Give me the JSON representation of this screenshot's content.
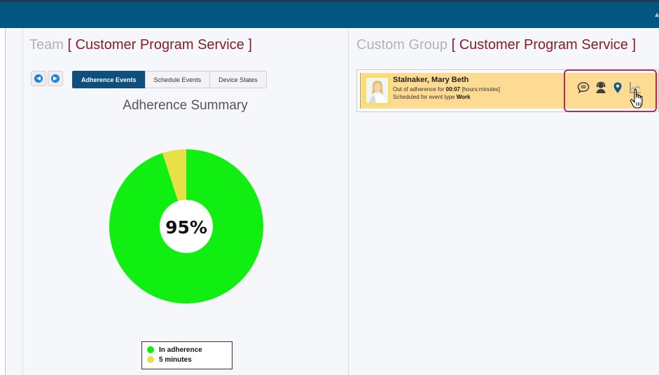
{
  "team_panel": {
    "title_prefix": "Team",
    "title_name": "[ Customer Program Service ]",
    "tabs": [
      "Adherence Events",
      "Schedule Events",
      "Device States"
    ],
    "active_tab": "Adherence Events",
    "chart_heading": "Adherence Summary"
  },
  "chart_data": {
    "type": "pie",
    "style": "donut",
    "center_label": "95%",
    "slices": [
      {
        "label": "In adherence",
        "value": 95,
        "color": "#11ee11"
      },
      {
        "label": "5 minutes",
        "value": 5,
        "color": "#e5e146"
      }
    ],
    "legend_placement": "bottom"
  },
  "group_panel": {
    "title_prefix": "Custom Group",
    "title_name": "[ Customer Program Service ]",
    "agent": {
      "name": "Stalnaker, Mary Beth",
      "adherence_prefix": "Out of adherence for",
      "duration": "00:07",
      "duration_unit": "[hours:minutes]",
      "schedule_prefix": "Scheduled for event type",
      "event_type": "Work"
    },
    "actions": [
      "chat-icon",
      "agent-icon",
      "location-icon",
      "trend-chart-icon"
    ]
  },
  "colors": {
    "topbar": "#01577f",
    "accent_red": "#8a1b28",
    "active_tab": "#0d4f7d",
    "card_highlight": "#fddb93",
    "action_highlight": "#b5266f"
  }
}
